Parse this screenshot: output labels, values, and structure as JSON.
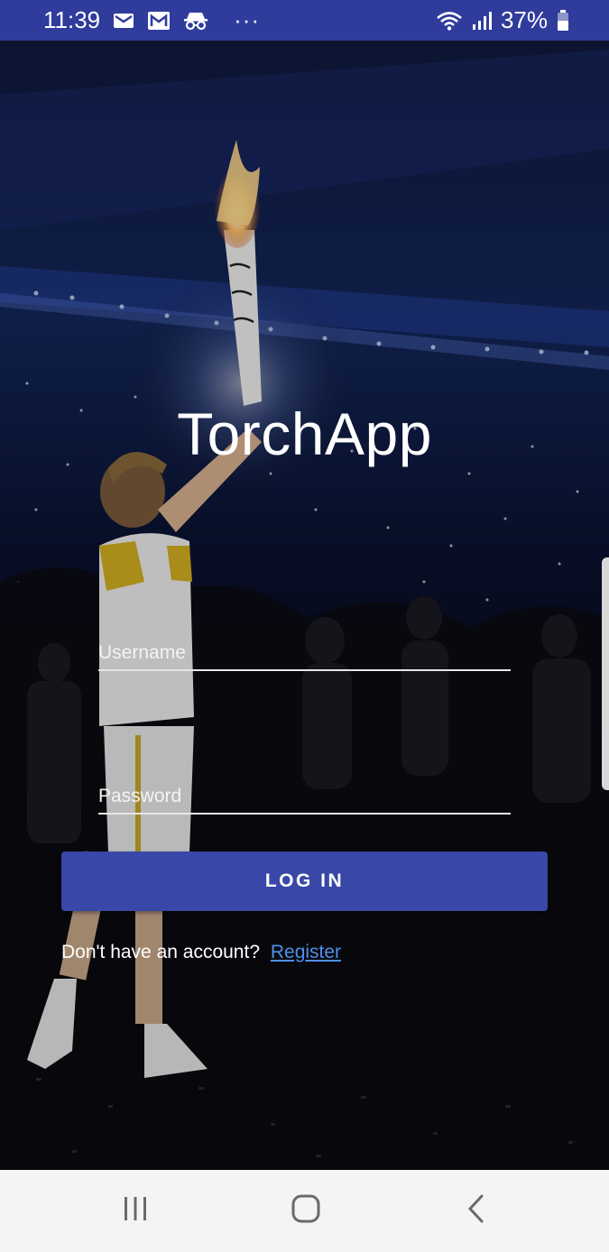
{
  "status_bar": {
    "time": "11:39",
    "battery": "37%",
    "overflow": "···",
    "icons": [
      "mail-icon",
      "gmail-icon",
      "incognito-icon",
      "wifi-icon",
      "signal-icon",
      "battery-icon"
    ]
  },
  "app": {
    "title": "TorchApp"
  },
  "form": {
    "username_placeholder": "Username",
    "username_value": "",
    "password_placeholder": "Password",
    "password_value": "",
    "login_label": "LOG IN",
    "register_prompt": "Don't have an account?",
    "register_link": "Register"
  },
  "colors": {
    "primary": "#3947a8",
    "status_bar": "#2f3c9c",
    "link": "#4f90ea"
  },
  "nav_bar": {
    "buttons": [
      "recents-icon",
      "home-icon",
      "back-icon"
    ]
  }
}
